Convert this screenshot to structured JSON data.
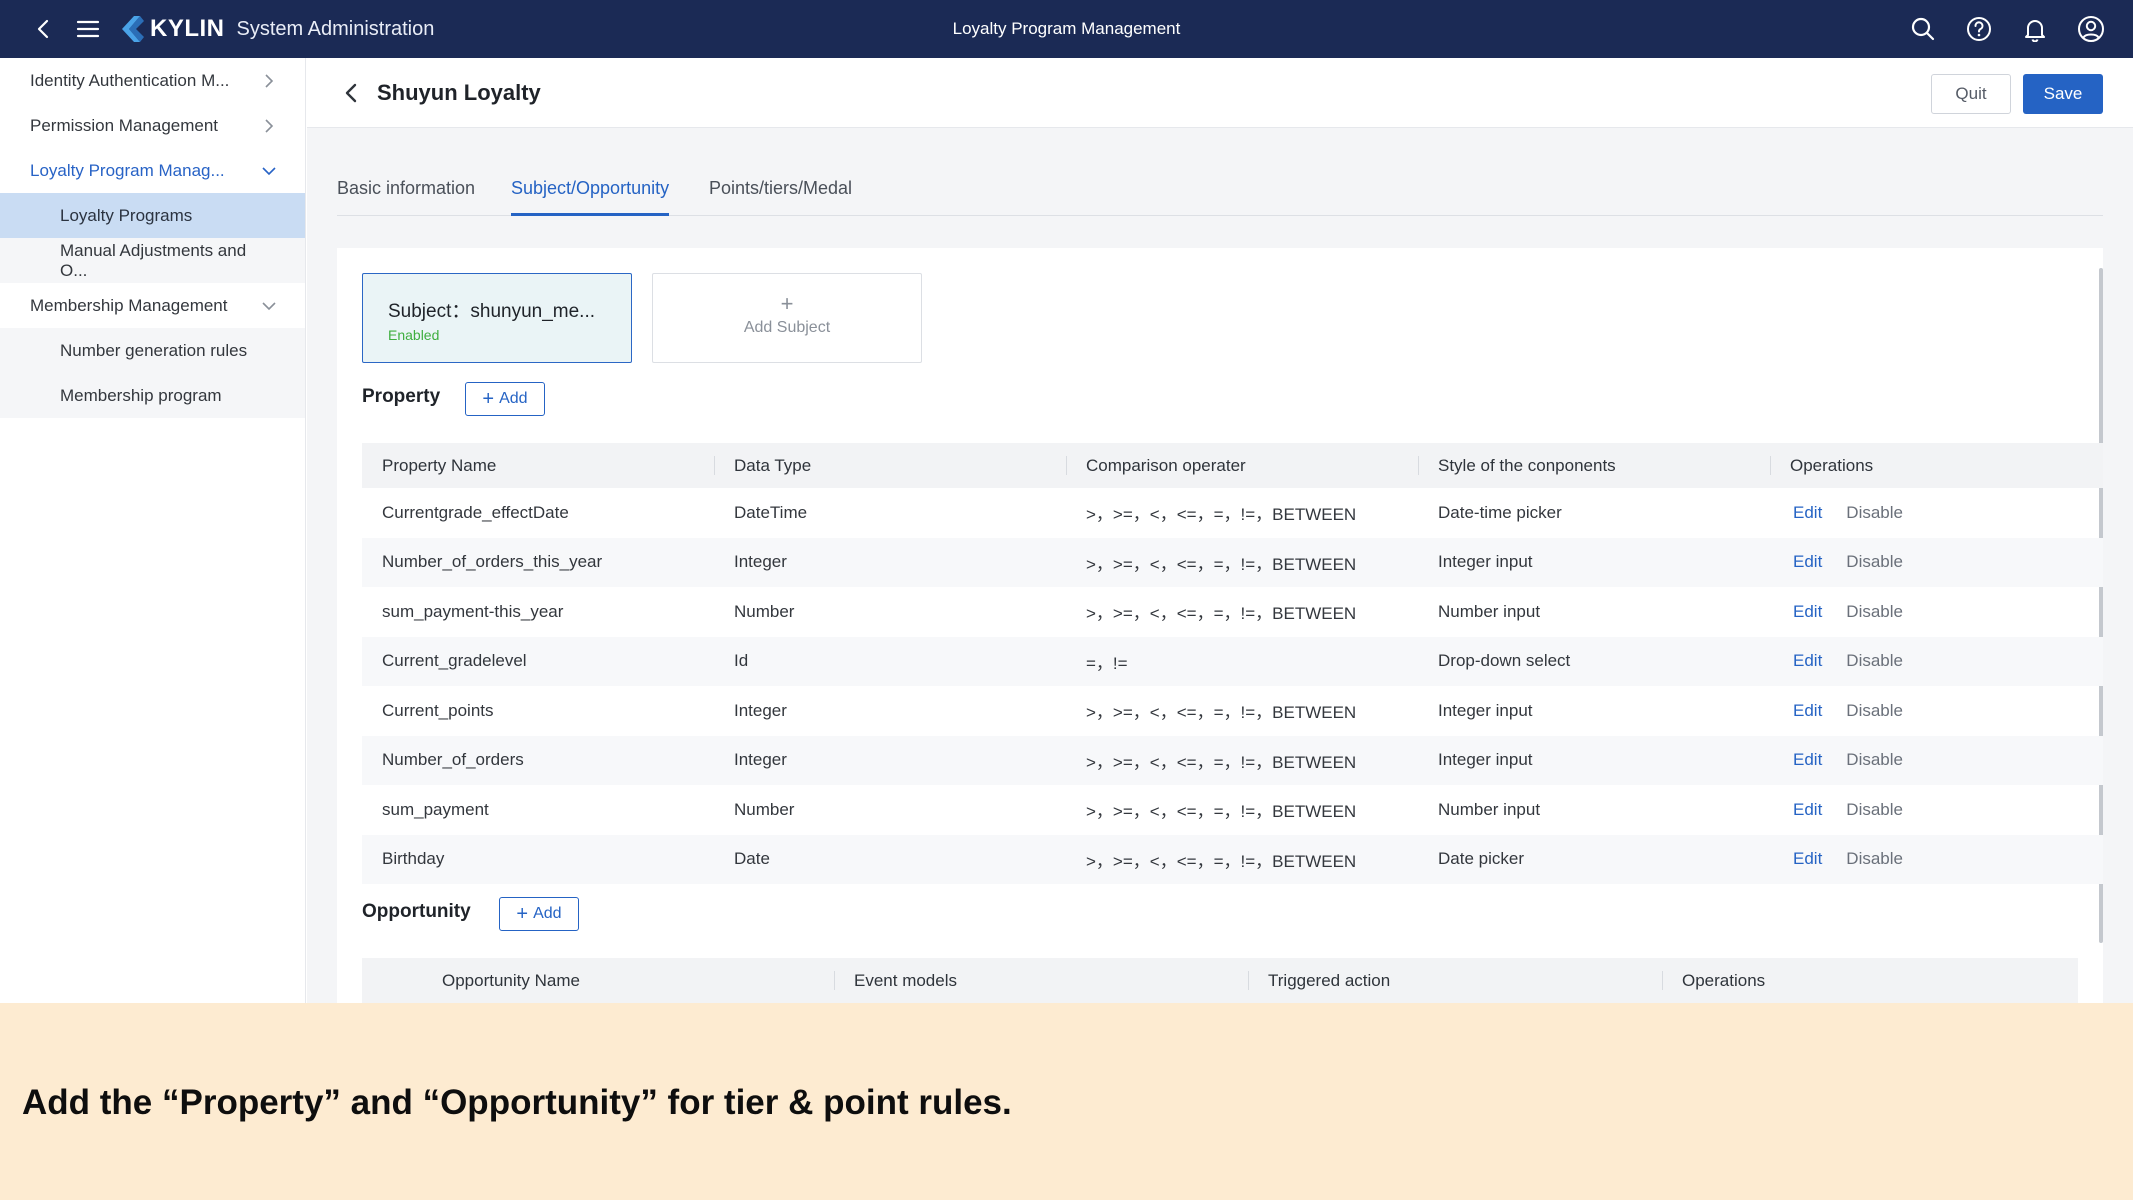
{
  "topbar": {
    "brand": "KYLIN",
    "brand_sub": "System Administration",
    "center_title": "Loyalty Program Management",
    "bg_color": "#1b2a55"
  },
  "sidebar": {
    "items": [
      {
        "label": "Identity Authentication M...",
        "type": "parent",
        "state": "collapsed"
      },
      {
        "label": "Permission Management",
        "type": "parent",
        "state": "collapsed"
      },
      {
        "label": "Loyalty Program Manag...",
        "type": "parent",
        "state": "expanded-active"
      },
      {
        "label": "Loyalty Programs",
        "type": "child",
        "state": "selected"
      },
      {
        "label": "Manual Adjustments and O...",
        "type": "child",
        "state": "normal"
      },
      {
        "label": "Membership Management",
        "type": "parent",
        "state": "expanded"
      },
      {
        "label": "Number generation rules",
        "type": "child",
        "state": "normal"
      },
      {
        "label": "Membership program",
        "type": "child",
        "state": "normal"
      }
    ]
  },
  "header": {
    "title": "Shuyun Loyalty",
    "quit_label": "Quit",
    "save_label": "Save"
  },
  "tabs": [
    {
      "label": "Basic information",
      "active": false
    },
    {
      "label": "Subject/Opportunity",
      "active": true
    },
    {
      "label": "Points/tiers/Medal",
      "active": false
    }
  ],
  "subject": {
    "title": "Subject：shunyun_me...",
    "status": "Enabled",
    "add_plus": "+",
    "add_label": "Add Subject"
  },
  "property": {
    "title": "Property",
    "add_label": "Add",
    "columns": [
      "Property Name",
      "Data Type",
      "Comparison operater",
      "Style of the conponents",
      "Operations"
    ],
    "rows": [
      {
        "name": "Currentgrade_effectDate",
        "type": "DateTime",
        "ops": ">，>=，<，<=，=，!=，BETWEEN",
        "style": "Date-time picker",
        "edit": "Edit",
        "disable": "Disable"
      },
      {
        "name": "Number_of_orders_this_year",
        "type": "Integer",
        "ops": ">，>=，<，<=，=，!=，BETWEEN",
        "style": "Integer input",
        "edit": "Edit",
        "disable": "Disable"
      },
      {
        "name": "sum_payment-this_year",
        "type": "Number",
        "ops": ">，>=，<，<=，=，!=，BETWEEN",
        "style": "Number input",
        "edit": "Edit",
        "disable": "Disable"
      },
      {
        "name": "Current_gradelevel",
        "type": "Id",
        "ops": "=，!=",
        "style": "Drop-down select",
        "edit": "Edit",
        "disable": "Disable"
      },
      {
        "name": "Current_points",
        "type": "Integer",
        "ops": ">，>=，<，<=，=，!=，BETWEEN",
        "style": "Integer input",
        "edit": "Edit",
        "disable": "Disable"
      },
      {
        "name": "Number_of_orders",
        "type": "Integer",
        "ops": ">，>=，<，<=，=，!=，BETWEEN",
        "style": "Integer input",
        "edit": "Edit",
        "disable": "Disable"
      },
      {
        "name": "sum_payment",
        "type": "Number",
        "ops": ">，>=，<，<=，=，!=，BETWEEN",
        "style": "Number input",
        "edit": "Edit",
        "disable": "Disable"
      },
      {
        "name": "Birthday",
        "type": "Date",
        "ops": ">，>=，<，<=，=，!=，BETWEEN",
        "style": "Date picker",
        "edit": "Edit",
        "disable": "Disable"
      }
    ]
  },
  "opportunity": {
    "title": "Opportunity",
    "add_label": "Add",
    "columns": [
      "Opportunity Name",
      "Event models",
      "Triggered action",
      "Operations"
    ]
  },
  "caption": {
    "text": "Add the “Property” and “Opportunity” for tier & point rules."
  },
  "colors": {
    "accent": "#2563c4",
    "selected_nav": "#c9dcf3",
    "enabled_status": "#3fae3f",
    "caption_bg": "#fdebd1"
  }
}
